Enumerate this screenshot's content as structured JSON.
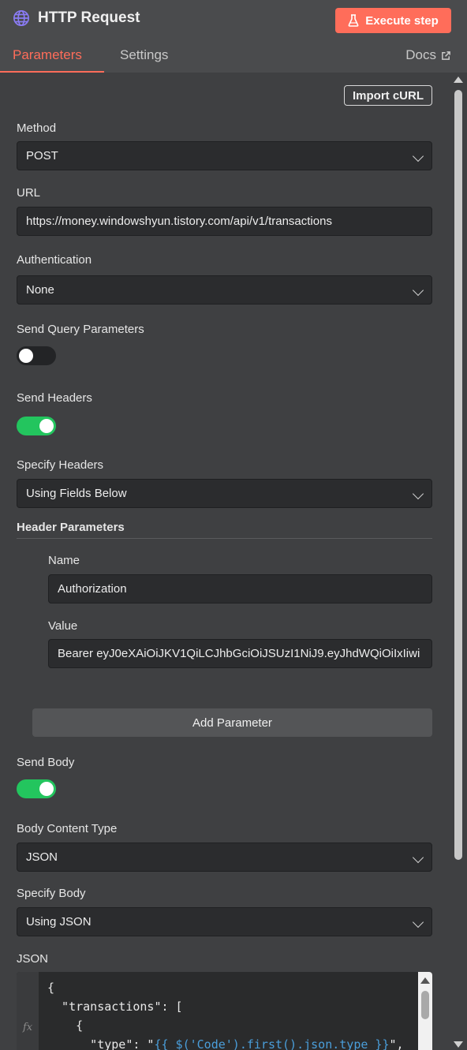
{
  "header": {
    "title": "HTTP Request",
    "execute_label": "Execute step",
    "tabs": [
      {
        "label": "Parameters",
        "active": true
      },
      {
        "label": "Settings",
        "active": false
      }
    ],
    "docs_label": "Docs"
  },
  "import_curl_label": "Import cURL",
  "method": {
    "label": "Method",
    "value": "POST"
  },
  "url": {
    "label": "URL",
    "value": "https://money.windowshyun.tistory.com/api/v1/transactions"
  },
  "authentication": {
    "label": "Authentication",
    "value": "None"
  },
  "send_query": {
    "label": "Send Query Parameters",
    "enabled": false
  },
  "send_headers": {
    "label": "Send Headers",
    "enabled": true
  },
  "specify_headers": {
    "label": "Specify Headers",
    "value": "Using Fields Below"
  },
  "header_parameters": {
    "label": "Header Parameters",
    "name_label": "Name",
    "name_value": "Authorization",
    "value_label": "Value",
    "value_value": "Bearer eyJ0eXAiOiJKV1QiLCJhbGciOiJSUzI1NiJ9.eyJhdWQiOiIxIiwi"
  },
  "add_parameter_label": "Add Parameter",
  "send_body": {
    "label": "Send Body",
    "enabled": true
  },
  "body_content_type": {
    "label": "Body Content Type",
    "value": "JSON"
  },
  "specify_body": {
    "label": "Specify Body",
    "value": "Using JSON"
  },
  "json": {
    "label": "JSON",
    "line1": "{",
    "line2": "  \"transactions\": [",
    "line3": "    {",
    "line4_prefix": "      \"type\": \"",
    "line4_expr": "{{ $('Code').first().json.type }}",
    "line4_suffix": "\","
  },
  "colors": {
    "accent": "#ff6d5a",
    "toggle_on": "#23c55e",
    "globe": "#7c6cf0",
    "expression": "#4a9eda"
  }
}
